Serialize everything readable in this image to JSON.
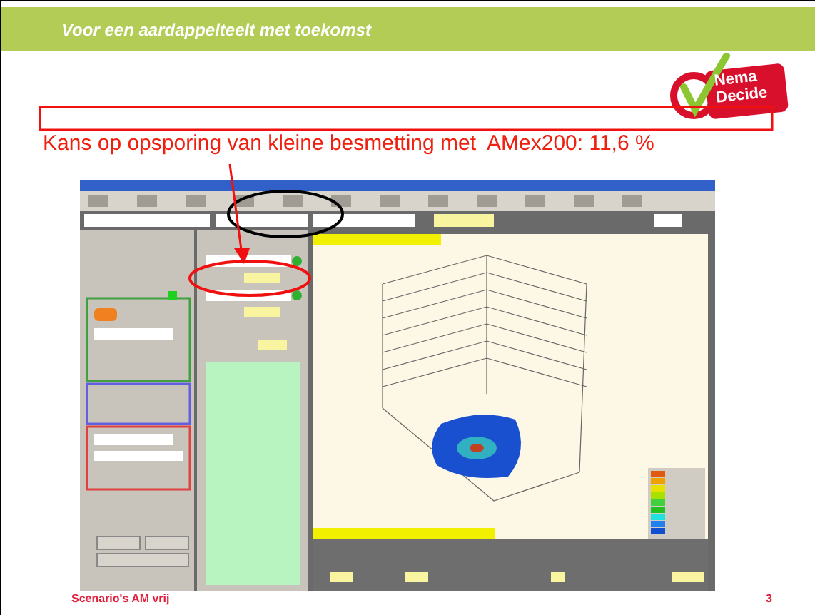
{
  "header": {
    "title": "Voor een aardappelteelt met toekomst"
  },
  "logo": {
    "lines": [
      "Nema",
      "Decide"
    ]
  },
  "callout": {
    "text": "Kans op opsporing van kleine besmetting met  AMex200: 11,6 %"
  },
  "footer": {
    "left": "Scenario's AM vrij",
    "page": "3"
  }
}
